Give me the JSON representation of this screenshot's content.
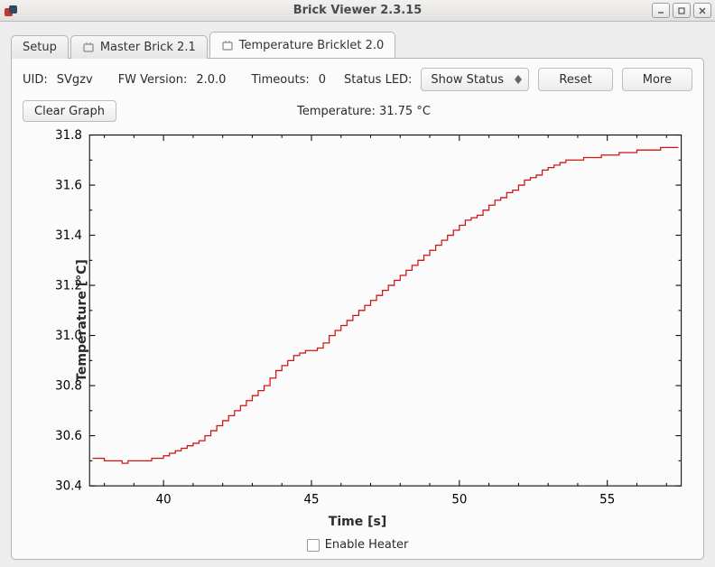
{
  "window": {
    "title": "Brick Viewer 2.3.15"
  },
  "tabs": {
    "setup": "Setup",
    "master": "Master Brick 2.1",
    "temp": "Temperature Bricklet 2.0"
  },
  "info": {
    "uid_label": "UID:",
    "uid_value": "SVgzv",
    "fw_label": "FW Version:",
    "fw_value": "2.0.0",
    "timeouts_label": "Timeouts:",
    "timeouts_value": "0",
    "statusled_label": "Status LED:",
    "statusled_value": "Show Status",
    "reset_label": "Reset",
    "more_label": "More"
  },
  "graph": {
    "clear_label": "Clear Graph",
    "title": "Temperature: 31.75 °C",
    "ylabel": "Temperature [°C]",
    "xlabel": "Time [s]"
  },
  "footer": {
    "heater_label": "Enable Heater"
  },
  "chart_data": {
    "type": "line",
    "xlabel": "Time [s]",
    "ylabel": "Temperature [°C]",
    "xlim": [
      37.5,
      57.5
    ],
    "ylim": [
      30.4,
      31.8
    ],
    "xticks": [
      40,
      45,
      50,
      55
    ],
    "yticks": [
      30.4,
      30.6,
      30.8,
      31.0,
      31.2,
      31.4,
      31.6,
      31.8
    ],
    "series": [
      {
        "name": "Temperature",
        "color": "#d01414",
        "x": [
          37.6,
          37.8,
          38.0,
          38.2,
          38.4,
          38.6,
          38.8,
          39.0,
          39.2,
          39.4,
          39.6,
          39.8,
          40.0,
          40.2,
          40.4,
          40.6,
          40.8,
          41.0,
          41.2,
          41.4,
          41.6,
          41.8,
          42.0,
          42.2,
          42.4,
          42.6,
          42.8,
          43.0,
          43.2,
          43.4,
          43.6,
          43.8,
          44.0,
          44.2,
          44.4,
          44.6,
          44.8,
          45.0,
          45.2,
          45.4,
          45.6,
          45.8,
          46.0,
          46.2,
          46.4,
          46.6,
          46.8,
          47.0,
          47.2,
          47.4,
          47.6,
          47.8,
          48.0,
          48.2,
          48.4,
          48.6,
          48.8,
          49.0,
          49.2,
          49.4,
          49.6,
          49.8,
          50.0,
          50.2,
          50.4,
          50.6,
          50.8,
          51.0,
          51.2,
          51.4,
          51.6,
          51.8,
          52.0,
          52.2,
          52.4,
          52.6,
          52.8,
          53.0,
          53.2,
          53.4,
          53.6,
          53.8,
          54.0,
          54.2,
          54.4,
          54.6,
          54.8,
          55.0,
          55.2,
          55.4,
          55.6,
          55.8,
          56.0,
          56.2,
          56.4,
          56.6,
          56.8,
          57.0,
          57.2,
          57.4
        ],
        "y": [
          30.51,
          30.51,
          30.5,
          30.5,
          30.5,
          30.49,
          30.5,
          30.5,
          30.5,
          30.5,
          30.51,
          30.51,
          30.52,
          30.53,
          30.54,
          30.55,
          30.56,
          30.57,
          30.58,
          30.6,
          30.62,
          30.64,
          30.66,
          30.68,
          30.7,
          30.72,
          30.74,
          30.76,
          30.78,
          30.8,
          30.83,
          30.86,
          30.88,
          30.9,
          30.92,
          30.93,
          30.94,
          30.94,
          30.95,
          30.97,
          31.0,
          31.02,
          31.04,
          31.06,
          31.08,
          31.1,
          31.12,
          31.14,
          31.16,
          31.18,
          31.2,
          31.22,
          31.24,
          31.26,
          31.28,
          31.3,
          31.32,
          31.34,
          31.36,
          31.38,
          31.4,
          31.42,
          31.44,
          31.46,
          31.47,
          31.48,
          31.5,
          31.52,
          31.54,
          31.55,
          31.57,
          31.58,
          31.6,
          31.62,
          31.63,
          31.64,
          31.66,
          31.67,
          31.68,
          31.69,
          31.7,
          31.7,
          31.7,
          31.71,
          31.71,
          31.71,
          31.72,
          31.72,
          31.72,
          31.73,
          31.73,
          31.73,
          31.74,
          31.74,
          31.74,
          31.74,
          31.75,
          31.75,
          31.75,
          31.75
        ]
      }
    ]
  }
}
